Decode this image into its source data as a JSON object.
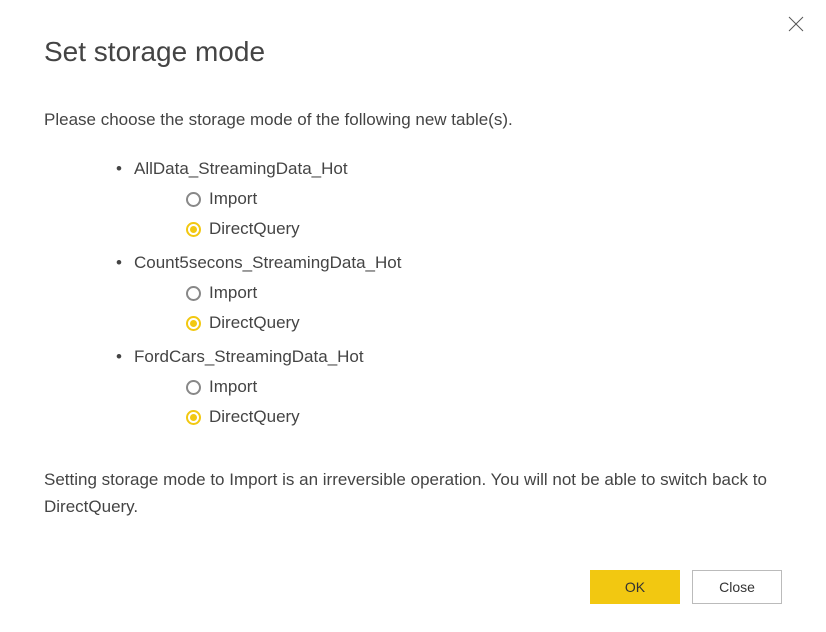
{
  "title": "Set storage mode",
  "instruction": "Please choose the storage mode of the following new table(s).",
  "tables": [
    {
      "name": "AllData_StreamingData_Hot",
      "options": [
        {
          "label": "Import",
          "selected": false
        },
        {
          "label": "DirectQuery",
          "selected": true
        }
      ]
    },
    {
      "name": "Count5secons_StreamingData_Hot",
      "options": [
        {
          "label": "Import",
          "selected": false
        },
        {
          "label": "DirectQuery",
          "selected": true
        }
      ]
    },
    {
      "name": "FordCars_StreamingData_Hot",
      "options": [
        {
          "label": "Import",
          "selected": false
        },
        {
          "label": "DirectQuery",
          "selected": true
        }
      ]
    }
  ],
  "warning": "Setting storage mode to Import is an irreversible operation. You will not be able to switch back to DirectQuery.",
  "buttons": {
    "ok": "OK",
    "close": "Close"
  }
}
